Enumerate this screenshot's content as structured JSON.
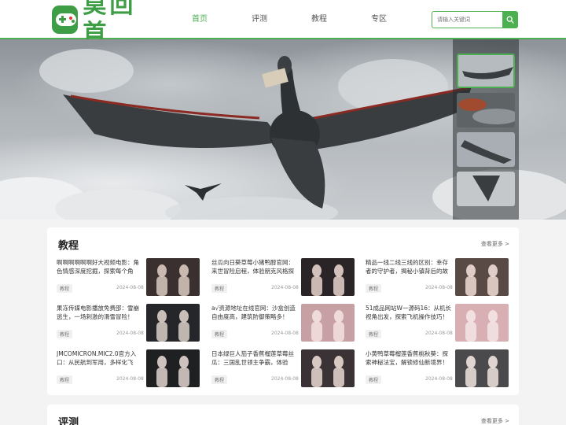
{
  "logo": {
    "text": "莫回首"
  },
  "nav": {
    "items": [
      "首页",
      "评测",
      "教程",
      "专区"
    ],
    "active_index": 0
  },
  "search": {
    "placeholder": "请输入关键词"
  },
  "sections": [
    {
      "title": "教程",
      "more": "查看更多 >",
      "cards": [
        {
          "title": "啊啊啊啊啊啊好大视频电影：角色情感深度挖掘，探索每个角色...",
          "tag": "教程",
          "date": "2024-08-08"
        },
        {
          "title": "丝瓜向日葵草莓小猪鸭醇官网：来世冒险启程，体验朋克风格探索！",
          "tag": "教程",
          "date": "2024-08-08"
        },
        {
          "title": "精品一线二线三线的区别：幸存者的守护者，揭秘小镇背后的故事！",
          "tag": "教程",
          "date": "2024-08-08"
        },
        {
          "title": "果冻传媒电影播放免费邵：雪崩逃生，一场刺激的滑雪冒险！",
          "tag": "教程",
          "date": "2024-08-08"
        },
        {
          "title": "a√资源地址在线官网：沙盒创造自由度高，建筑防御策略多！",
          "tag": "教程",
          "date": "2024-08-08"
        },
        {
          "title": "51成品网站W一源码16：从机长视角出发，探索飞机操作技巧！",
          "tag": "教程",
          "date": "2024-08-08"
        },
        {
          "title": "JMCOMICRON.MIC2.0官方入口：从民航到军用，多样化飞机...",
          "tag": "教程",
          "date": "2024-08-08"
        },
        {
          "title": "日本绿巨人茄子香蕉榴莲草莓丝瓜：三国乱世领主争霸，体验放...",
          "tag": "教程",
          "date": "2024-08-08"
        },
        {
          "title": "小黄鸭草莓榴莲香蕉桃秋葵：探索神秘法宝，解锁修仙新境界！",
          "tag": "教程",
          "date": "2024-08-08"
        }
      ]
    },
    {
      "title": "评测",
      "more": "查看更多 >"
    }
  ],
  "colors": {
    "accent": "#4caf50",
    "logo": "#3e9e46"
  }
}
